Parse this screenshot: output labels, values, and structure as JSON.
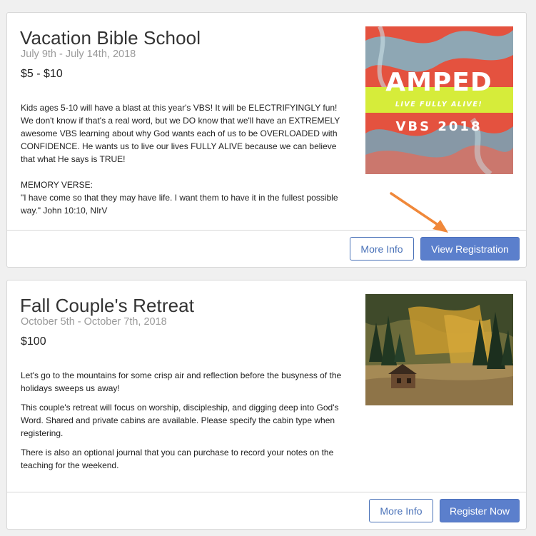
{
  "events": [
    {
      "title": "Vacation Bible School",
      "dates": "July 9th - July 14th, 2018",
      "price": "$5 - $10",
      "paragraphs": [
        "Kids ages 5-10 will have a blast at this year's VBS! It will be ELECTRIFYINGLY fun! We don't know if that's a real word, but we DO know that we'll have an EXTREMELY awesome VBS learning about why God wants each of us to be OVERLOADED with CONFIDENCE. He wants us to live our lives FULLY ALIVE because we can believe that what He says is TRUE!",
        "MEMORY VERSE:\n\"I have come so that they may have life. I want them to have it in the fullest possible way.\" John 10:10, NIrV"
      ],
      "image": {
        "word": "AMPED",
        "tagline": "LIVE FULLY ALIVE!",
        "subtitle": "VBS 2018"
      },
      "more_info_label": "More Info",
      "action_label": "View Registration"
    },
    {
      "title": "Fall Couple's Retreat",
      "dates": "October 5th - October 7th, 2018",
      "price": "$100",
      "paragraphs": [
        "Let's go to the mountains for some crisp air and reflection before the busyness of the holidays sweeps us away!",
        "This couple's retreat will focus on worship, discipleship, and digging deep into God's Word. Shared and private cabins are available. Please specify the cabin type when registering.",
        "There is also an optional journal that you can purchase to record your notes on the teaching for the weekend."
      ],
      "image": {
        "icon": "mountain-cabin-photo"
      },
      "more_info_label": "More Info",
      "action_label": "Register Now"
    }
  ],
  "colors": {
    "accent": "#5b7fcc",
    "outline": "#4a72b8",
    "arrow": "#f0883a",
    "amped_band": "#d6ec3a"
  }
}
